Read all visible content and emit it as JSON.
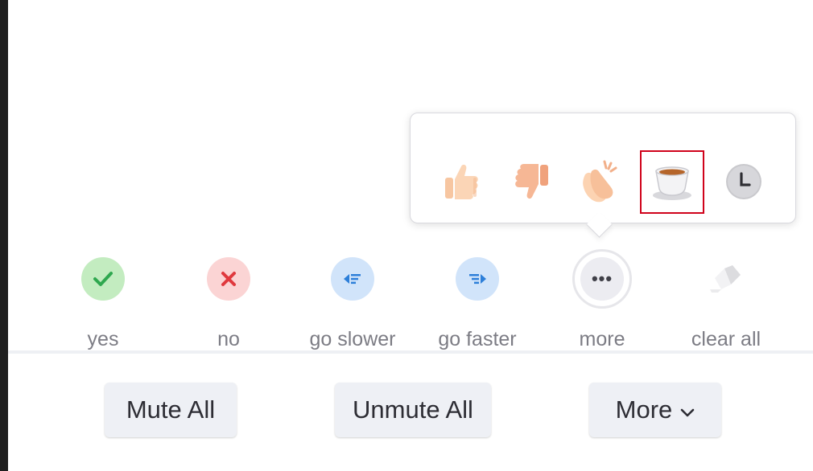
{
  "reactions_popup": {
    "items": [
      {
        "name": "thumbs-up",
        "selected": false
      },
      {
        "name": "thumbs-down",
        "selected": false
      },
      {
        "name": "clapping-hands",
        "selected": false
      },
      {
        "name": "coffee-cup",
        "selected": true
      },
      {
        "name": "clock",
        "selected": false
      }
    ]
  },
  "feedback": {
    "yes_label": "yes",
    "no_label": "no",
    "slower_label": "go slower",
    "faster_label": "go faster",
    "more_label": "more",
    "more_dots": "•••",
    "clear_label": "clear all"
  },
  "buttons": {
    "mute_all": "Mute All",
    "unmute_all": "Unmute All",
    "more": "More"
  },
  "colors": {
    "yes_bg": "#c3ecc0",
    "yes_fg": "#2fa84f",
    "no_bg": "#fbd4d4",
    "no_fg": "#e0393e",
    "speed_bg": "#d1e4fa",
    "speed_fg": "#2d7fd9",
    "highlight": "#d0021b"
  }
}
